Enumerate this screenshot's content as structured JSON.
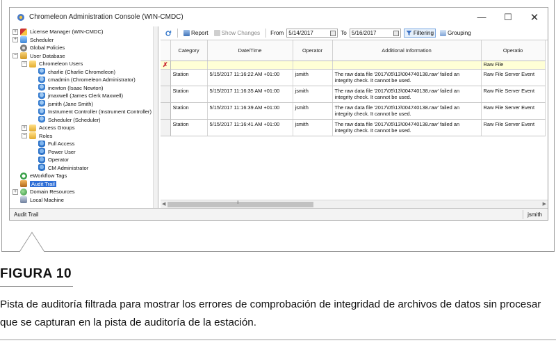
{
  "window": {
    "title": "Chromeleon Administration Console (WIN-CMDC)",
    "minimize": "—",
    "maximize": "☐",
    "close": "✕"
  },
  "tree": [
    {
      "label": "License Manager (WIN-CMDC)",
      "indent": 0,
      "exp": "+",
      "icon": "lic"
    },
    {
      "label": "Scheduler",
      "indent": 0,
      "exp": "+",
      "icon": "sched"
    },
    {
      "label": "Global Policies",
      "indent": 0,
      "exp": "",
      "icon": "gear"
    },
    {
      "label": "User Database",
      "indent": 0,
      "exp": "−",
      "icon": "db"
    },
    {
      "label": "Chromeleon Users",
      "indent": 1,
      "exp": "−",
      "icon": "folder"
    },
    {
      "label": "charlie (Charlie Chromeleon)",
      "indent": 2,
      "exp": "",
      "icon": "user"
    },
    {
      "label": "cmadmin (Chromeleon Administrator)",
      "indent": 2,
      "exp": "",
      "icon": "user"
    },
    {
      "label": "inewton (Isaac Newton)",
      "indent": 2,
      "exp": "",
      "icon": "user"
    },
    {
      "label": "jmaxwell (James Clerk Maxwell)",
      "indent": 2,
      "exp": "",
      "icon": "user"
    },
    {
      "label": "jsmith (Jane Smith)",
      "indent": 2,
      "exp": "",
      "icon": "user"
    },
    {
      "label": "Instrument Controller (Instrument Controller)",
      "indent": 2,
      "exp": "",
      "icon": "user"
    },
    {
      "label": "Scheduler (Scheduler)",
      "indent": 2,
      "exp": "",
      "icon": "user"
    },
    {
      "label": "Access Groups",
      "indent": 1,
      "exp": "+",
      "icon": "folder"
    },
    {
      "label": "Roles",
      "indent": 1,
      "exp": "−",
      "icon": "folder"
    },
    {
      "label": "Full Access",
      "indent": 2,
      "exp": "",
      "icon": "role"
    },
    {
      "label": "Power User",
      "indent": 2,
      "exp": "",
      "icon": "role"
    },
    {
      "label": "Operator",
      "indent": 2,
      "exp": "",
      "icon": "role"
    },
    {
      "label": "CM Administrator",
      "indent": 2,
      "exp": "",
      "icon": "role"
    },
    {
      "label": "eWorkflow Tags",
      "indent": 0,
      "exp": "",
      "icon": "flow"
    },
    {
      "label": "Audit Trail",
      "indent": 0,
      "exp": "",
      "icon": "audit",
      "selected": true
    },
    {
      "label": "Domain Resources",
      "indent": 0,
      "exp": "+",
      "icon": "globe"
    },
    {
      "label": "Local Machine",
      "indent": 0,
      "exp": "",
      "icon": "pc"
    }
  ],
  "toolbar": {
    "report": "Report",
    "show_changes": "Show Changes",
    "from_label": "From",
    "from_date": "5/14/2017",
    "to_label": "To",
    "to_date": "5/16/2017",
    "filtering": "Filtering",
    "grouping": "Grouping"
  },
  "grid": {
    "headers": [
      "Category",
      "Date/Time",
      "Operator",
      "Additional Information",
      "Operatio"
    ],
    "filter_row": {
      "mark": "✗",
      "operation": "Raw File"
    },
    "rows": [
      {
        "category": "Station",
        "datetime": "5/15/2017 11:16:22 AM +01:00",
        "operator": "jsmith",
        "info": "The raw data file '2017\\05\\13\\004740138.raw' failed an integrity check. It cannot be used.",
        "operation": "Raw File Server Event"
      },
      {
        "category": "Station",
        "datetime": "5/15/2017 11:16:35 AM +01:00",
        "operator": "jsmith",
        "info": "The raw data file '2017\\05\\13\\004740138.raw' failed an integrity check. It cannot be used.",
        "operation": "Raw File Server Event"
      },
      {
        "category": "Station",
        "datetime": "5/15/2017 11:16:39 AM +01:00",
        "operator": "jsmith",
        "info": "The raw data file '2017\\05\\13\\004740138.raw' failed an integrity check. It cannot be used.",
        "operation": "Raw File Server Event"
      },
      {
        "category": "Station",
        "datetime": "5/15/2017 11:16:41 AM +01:00",
        "operator": "jsmith",
        "info": "The raw data file '2017\\05\\13\\004740138.raw' failed an integrity check. It cannot be used.",
        "operation": "Raw File Server Event"
      }
    ]
  },
  "hscroll_thumb": "⦀",
  "statusbar": {
    "left": "Audit Trail",
    "user": "jsmith"
  },
  "figure": {
    "title": "FIGURA 10",
    "caption": "Pista de auditoría filtrada para mostrar los errores de comprobación de integridad de archivos de datos sin procesar que se capturan en la pista de auditoría de la estación."
  }
}
